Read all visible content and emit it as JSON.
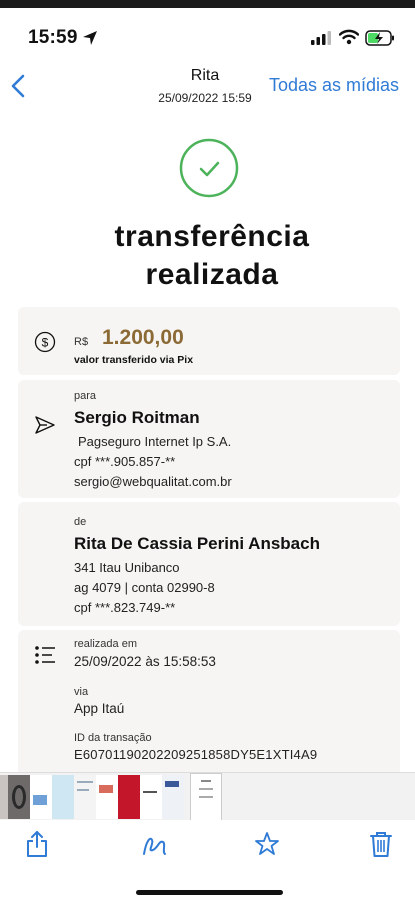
{
  "status_bar": {
    "time": "15:59"
  },
  "nav": {
    "title": "Rita",
    "subtitle": "25/09/2022 15:59",
    "action": "Todas as mídias"
  },
  "receipt": {
    "headline_line1": "transferência",
    "headline_line2": "realizada",
    "currency": "R$",
    "amount": "1.200,00",
    "amount_caption": "valor transferido via Pix",
    "to": {
      "label": "para",
      "name": "Sergio Roitman",
      "bank": "Pagseguro Internet Ip S.A.",
      "cpf": "cpf ***.905.857-**",
      "email": "sergio@webqualitat.com.br"
    },
    "from": {
      "label": "de",
      "name": "Rita De Cassia Perini Ansbach",
      "bank": "341 Itau Unibanco",
      "account": "ag 4079 | conta 02990-8",
      "cpf": "cpf ***.823.749-**"
    },
    "details": {
      "date_label": "realizada em",
      "date_value": "25/09/2022 às 15:58:53",
      "via_label": "via",
      "via_value": "App Itaú",
      "id_label": "ID da transação",
      "id_value": "E60701190202209251858DY5E1XTI4A9"
    }
  },
  "toolbar": {
    "icons": [
      "share-icon",
      "markup-icon",
      "favorite-star-icon",
      "trash-icon"
    ]
  },
  "colors": {
    "accent_blue": "#2f7bd6",
    "success_green": "#4cb35a",
    "amount_brown": "#8b6a35",
    "card_bg": "#f6f5f3"
  }
}
